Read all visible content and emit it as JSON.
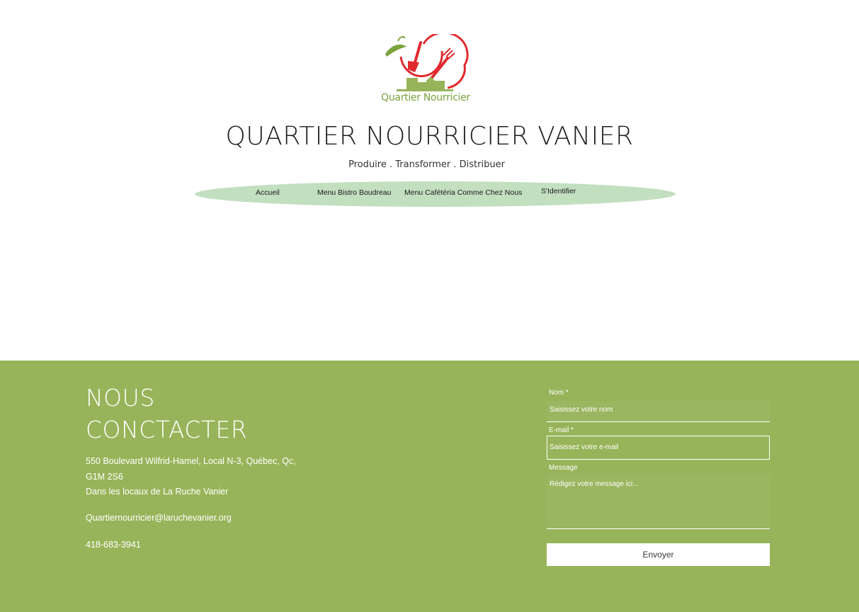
{
  "logo": {
    "text": "Quartier Nourricier",
    "colors": {
      "red": "#e02a2f",
      "green": "#7aa33c"
    }
  },
  "header": {
    "title": "QUARTIER NOURRICIER VANIER",
    "tagline": "Produire . Transformer . Distribuer"
  },
  "nav": {
    "items": [
      {
        "label": "Accueil"
      },
      {
        "label": "Menu Bistro Boudreau"
      },
      {
        "label": "Menu Cafétéria Comme Chez Nous"
      },
      {
        "label": "S'Identifier"
      }
    ],
    "background": "#c2dfc0"
  },
  "footer": {
    "background": "#98b45a",
    "title_line1": "NOUS",
    "title_line2": "CONCTACTER",
    "address_line1": "550 Boulevard Wilfrid-Hamel, Local N-3, Québec, Qc,",
    "address_line2": "G1M 2S6",
    "address_line3": "Dans les locaux de La Ruche Vanier",
    "email": "Quartiernourricier@laruchevanier.org",
    "phone": "418-683-3941"
  },
  "form": {
    "name_label": "Nom *",
    "name_placeholder": "Saisissez votre nom",
    "email_label": "E-mail *",
    "email_placeholder": "Saisissez votre e-mail",
    "message_label": "Message",
    "message_placeholder": "Rédigez votre message ici...",
    "submit_label": "Envoyer"
  }
}
